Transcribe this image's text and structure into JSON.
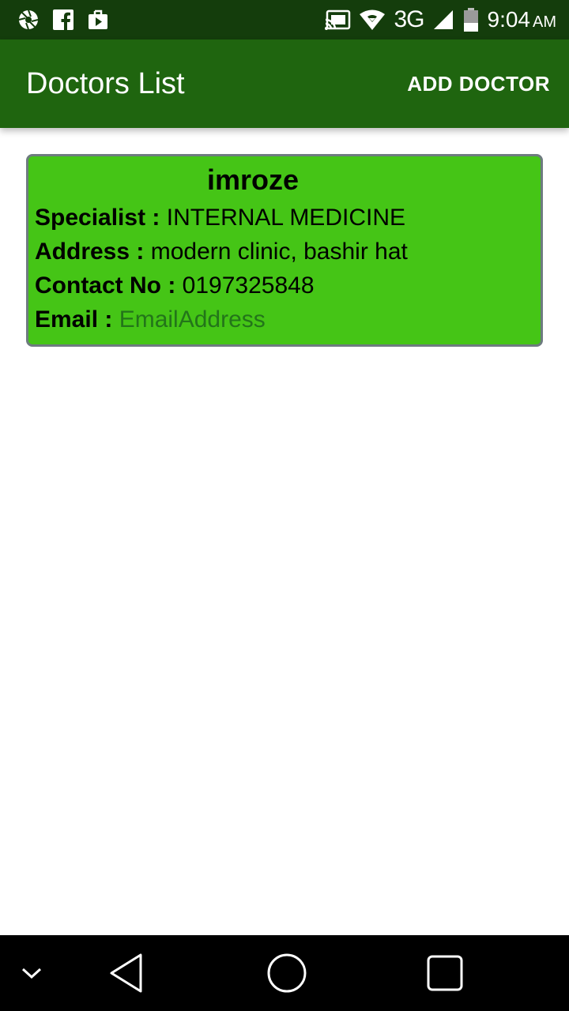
{
  "status_bar": {
    "icons_left": [
      "shutter-icon",
      "facebook-icon",
      "play-store-icon"
    ],
    "icons_right": [
      "cast-icon",
      "wifi-icon",
      "signal-icon",
      "battery-icon"
    ],
    "network": "3G",
    "time": "9:04",
    "ampm": "AM"
  },
  "app_bar": {
    "title": "Doctors List",
    "action_label": "ADD DOCTOR"
  },
  "doctor": {
    "name": "imroze",
    "specialist_label": "Specialist : ",
    "specialist_value": "INTERNAL MEDICINE",
    "address_label": "Address : ",
    "address_value": "modern clinic, bashir hat",
    "contact_label": "Contact No : ",
    "contact_value": "0197325848",
    "email_label": "Email : ",
    "email_value": "EmailAddress"
  },
  "nav_bar": {
    "icons": [
      "chevron-down-icon",
      "back-icon",
      "home-icon",
      "recents-icon"
    ]
  },
  "colors": {
    "status_bar": "#143d0c",
    "app_bar": "#1f650f",
    "card": "#45c516",
    "card_border": "#6e7b7f",
    "email_placeholder": "#23751a"
  }
}
